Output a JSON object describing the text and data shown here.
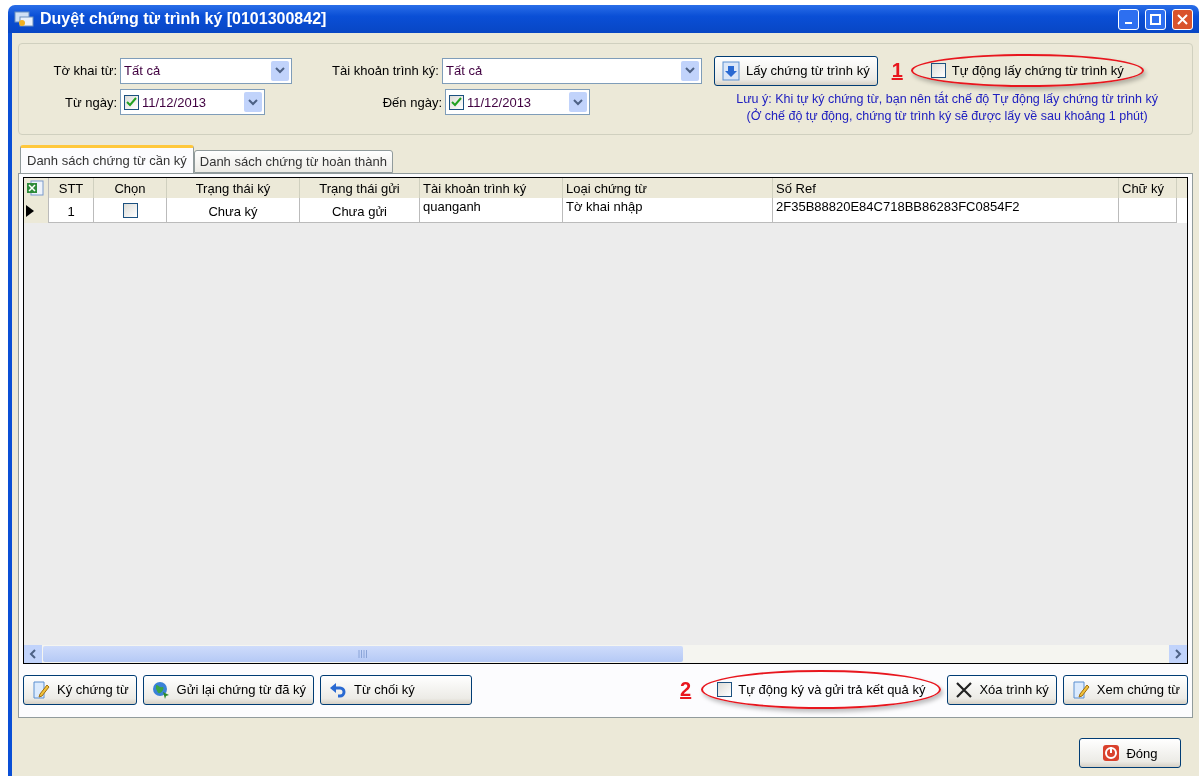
{
  "window": {
    "title": "Duyệt chứng từ trình ký [0101300842]"
  },
  "filters_row1": [
    {
      "kind": "combo",
      "label": "Tờ khai từ:",
      "value": "Tất cả"
    },
    {
      "kind": "combo",
      "label": "Tài khoản trình ký:",
      "value": "Tất cả"
    }
  ],
  "fetch_button": {
    "label": "Lấy chứng từ trình ký"
  },
  "auto_fetch": {
    "marker": "1",
    "label": "Tự động lấy chứng từ trình ký",
    "checked": false
  },
  "filters_row2": [
    {
      "kind": "date",
      "label": "Từ ngày:",
      "value": "11/12/2013",
      "checked": true
    },
    {
      "kind": "date",
      "label": "Đến ngày:",
      "value": "11/12/2013",
      "checked": true
    }
  ],
  "note": [
    "Lưu ý: Khi tự ký chứng từ, bạn nên tắt chế độ Tự động lấy chứng từ trình ký",
    "(Ở chế độ tự động, chứng từ trình ký sẽ được lấy về sau khoảng 1 phút)"
  ],
  "tabs": [
    {
      "label": "Danh sách chứng từ cần ký",
      "selected": true
    },
    {
      "label": "Danh sách chứng từ hoàn thành",
      "selected": false
    }
  ],
  "table": {
    "columns": [
      {
        "label": "STT",
        "kind": "text"
      },
      {
        "label": "Chọn",
        "kind": "check"
      },
      {
        "label": "Trạng thái ký",
        "kind": "text"
      },
      {
        "label": "Trạng thái gửi",
        "kind": "text"
      },
      {
        "label": "Tài khoản trình ký",
        "kind": "text"
      },
      {
        "label": "Loại chứng từ",
        "kind": "text"
      },
      {
        "label": "Số Ref",
        "kind": "text"
      },
      {
        "label": "Chữ ký",
        "kind": "text"
      }
    ],
    "rows": [
      {
        "current": true,
        "cells": [
          {
            "text": "1"
          },
          {
            "checked": false
          },
          {
            "text": "Chưa ký"
          },
          {
            "text": "Chưa  gửi"
          },
          {
            "text": "quanganh"
          },
          {
            "text": "Tờ khai nhập"
          },
          {
            "text": "2F35B88820E84C718BB86283FC0854F2"
          }
        ]
      }
    ]
  },
  "left_buttons": [
    {
      "label": "Ký chứng từ"
    },
    {
      "label": "Gửi lại chứng từ đã ký"
    },
    {
      "label": "Từ chối ký"
    }
  ],
  "auto_sign": {
    "marker": "2",
    "label": "Tự động ký và gửi trả kết quả ký",
    "checked": false
  },
  "right_buttons": [
    {
      "label": "Xóa trình ký"
    },
    {
      "label": "Xem chứng từ"
    }
  ],
  "close_button": {
    "label": "Đóng"
  }
}
